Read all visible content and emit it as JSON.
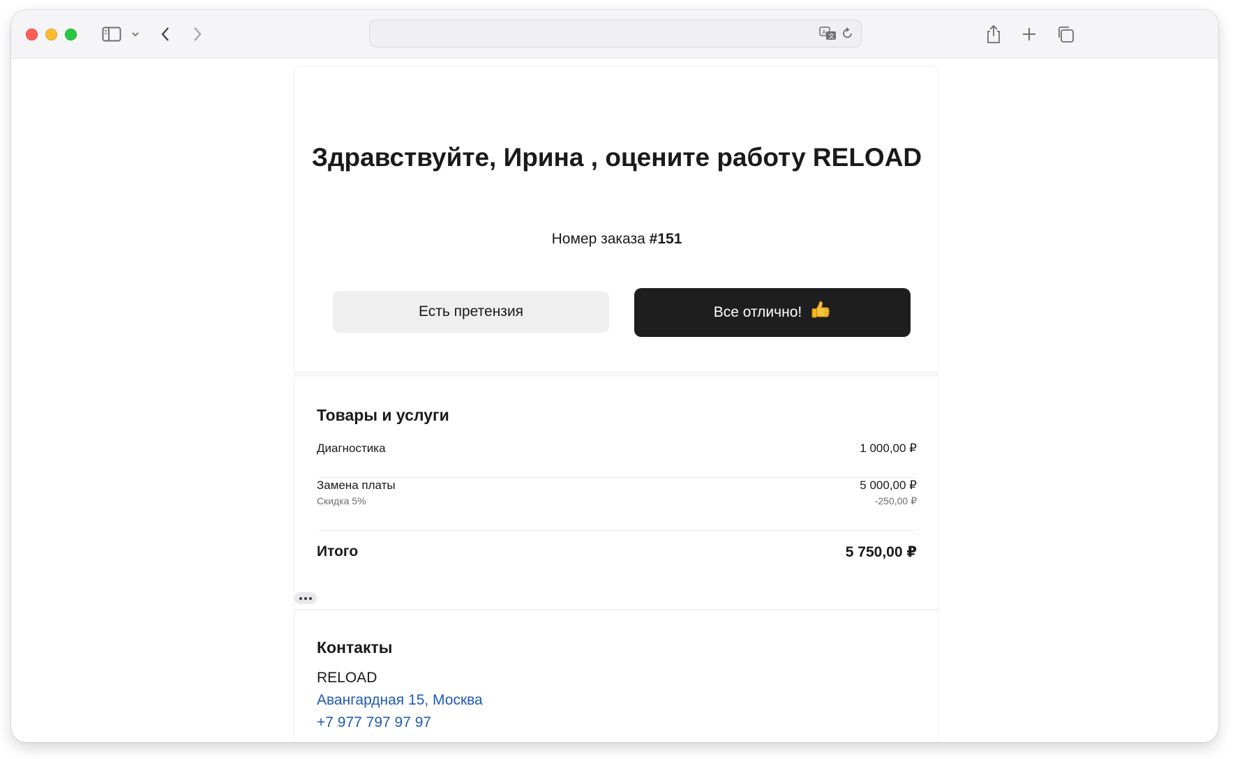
{
  "browser": {
    "address_value": "",
    "icons": [
      "sidebar-icon",
      "chevron-down-icon",
      "back-icon",
      "forward-icon",
      "translate-icon",
      "reload-icon",
      "share-icon",
      "new-tab-icon",
      "tab-overview-icon"
    ]
  },
  "header": {
    "greeting": "Здравствуйте,  Ирина , оцените работу RELOAD",
    "order_label": "Номер заказа ",
    "order_number": "#151"
  },
  "actions": {
    "claim_label": "Есть претензия",
    "ok_label": "Все отлично!",
    "ok_emoji": "👍"
  },
  "goods": {
    "title": "Товары и услуги",
    "items": [
      {
        "name": "Диагностика",
        "price": "1 000,00 ₽"
      },
      {
        "name": "Замена платы",
        "price": "5 000,00 ₽",
        "note": "Скидка 5%",
        "discount": "-250,00 ₽"
      }
    ],
    "total_label": "Итого",
    "total_value": "5 750,00 ₽"
  },
  "contacts": {
    "title": "Контакты",
    "company": "RELOAD",
    "address": "Авангардная 15, Москва",
    "phone": "+7 977 797 97 97"
  },
  "colors": {
    "accent_dark": "#1e1e1e",
    "link": "#1f5ab5",
    "close": "#ff5f57",
    "minimize": "#febc2e",
    "maximize": "#28c840"
  }
}
